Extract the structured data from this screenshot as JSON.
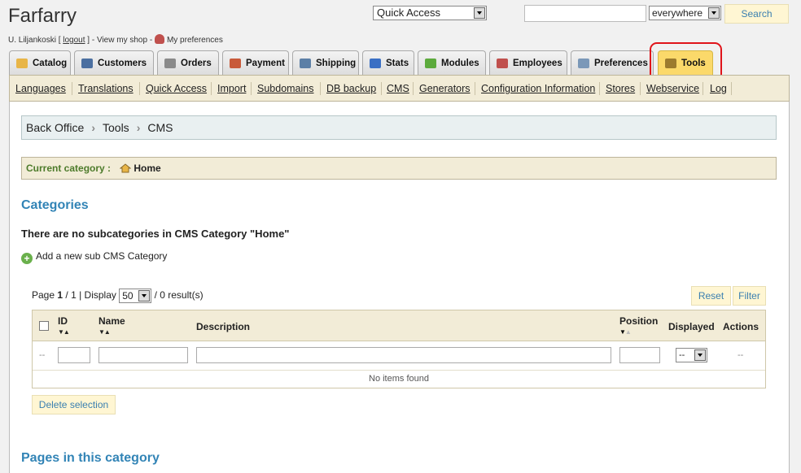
{
  "header": {
    "shop_name": "Farfarry",
    "user_name": "U. Liljankoski",
    "open_bracket": "[",
    "logout": "logout",
    "close_bracket": "] -",
    "view_shop": "View my shop",
    "sep": "-",
    "preferences": "My preferences",
    "quick_access": "Quick Access",
    "search_value": "",
    "search_scope": "everywhere",
    "search_button": "Search"
  },
  "tabs": [
    {
      "label": "Catalog",
      "icon": "folder-icon",
      "color": "#e8b547"
    },
    {
      "label": "Customers",
      "icon": "user-icon",
      "color": "#4b6fa0"
    },
    {
      "label": "Orders",
      "icon": "cart-icon",
      "color": "#8a8a8a"
    },
    {
      "label": "Payment",
      "icon": "payment-icon",
      "color": "#c85a3a"
    },
    {
      "label": "Shipping",
      "icon": "truck-icon",
      "color": "#5c7fa6"
    },
    {
      "label": "Stats",
      "icon": "chart-icon",
      "color": "#3a6fc4"
    },
    {
      "label": "Modules",
      "icon": "puzzle-icon",
      "color": "#5caa3c"
    },
    {
      "label": "Employees",
      "icon": "employee-icon",
      "color": "#c0504d"
    },
    {
      "label": "Preferences",
      "icon": "preferences-icon",
      "color": "#7b98b8"
    },
    {
      "label": "Tools",
      "icon": "wrench-icon",
      "color": "#9c7b2e"
    }
  ],
  "active_tab": "Tools",
  "subnav": [
    "Languages",
    "Translations",
    "Quick Access",
    "Import",
    "Subdomains",
    "DB backup",
    "CMS",
    "Generators",
    "Configuration Information",
    "Stores",
    "Webservice",
    "Log"
  ],
  "breadcrumb": [
    "Back Office",
    "Tools",
    "CMS"
  ],
  "current_category": {
    "label": "Current category :",
    "value": "Home"
  },
  "categories": {
    "heading": "Categories",
    "empty_msg": "There are no subcategories in CMS Category \"Home\"",
    "add_link": "Add a new sub CMS Category"
  },
  "pager": {
    "page_word": "Page",
    "page": "1",
    "total_pages": "/ 1",
    "display_word": "| Display",
    "per_page": "50",
    "results": "/ 0 result(s)"
  },
  "buttons": {
    "reset": "Reset",
    "filter": "Filter",
    "delete_selection": "Delete selection"
  },
  "table": {
    "headers": {
      "id": "ID",
      "name": "Name",
      "description": "Description",
      "position": "Position",
      "displayed": "Displayed",
      "actions": "Actions"
    },
    "filter_dash": "--",
    "displayed_filter": "--",
    "empty": "No items found"
  },
  "pages_heading": "Pages in this category",
  "colors": {
    "accent_blue": "#3284b6",
    "active_tab": "#fbd96a",
    "subnav_bg": "#f2ecd7",
    "highlight": "#e0141a"
  }
}
